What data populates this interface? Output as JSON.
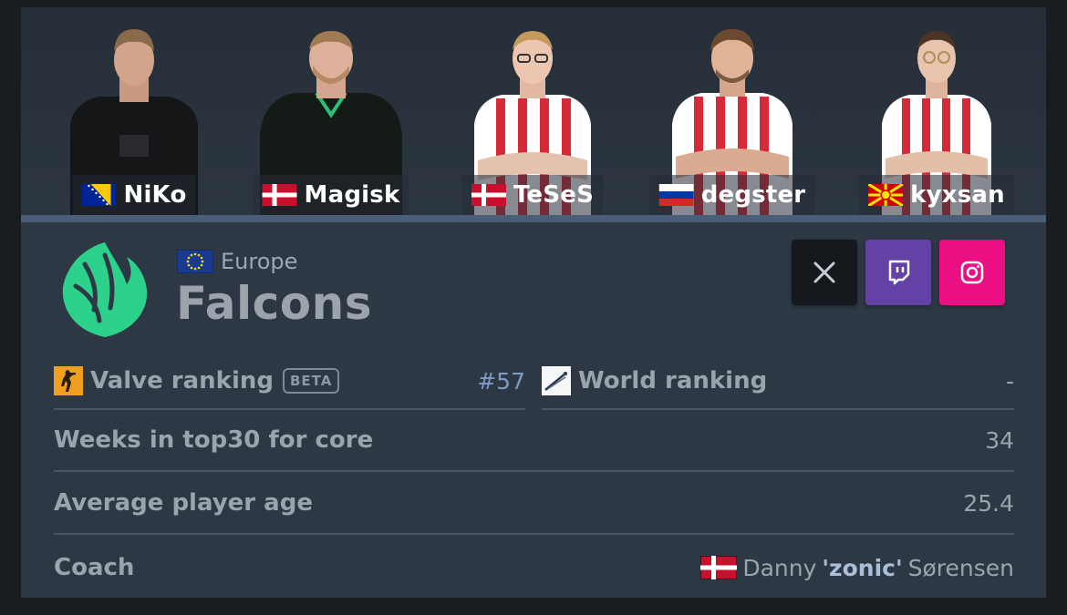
{
  "roster": [
    {
      "name": "NiKo",
      "flag": "bosnia"
    },
    {
      "name": "Magisk",
      "flag": "denmark"
    },
    {
      "name": "TeSeS",
      "flag": "denmark"
    },
    {
      "name": "degster",
      "flag": "russia"
    },
    {
      "name": "kyxsan",
      "flag": "north-macedonia"
    }
  ],
  "team": {
    "region": "Europe",
    "name": "Falcons",
    "brand_color": "#2cd28c"
  },
  "socials": [
    {
      "icon": "x-icon",
      "color": "#15191e"
    },
    {
      "icon": "twitch-icon",
      "color": "#6441a5"
    },
    {
      "icon": "instagram-icon",
      "color": "#ea0f82"
    }
  ],
  "stats": {
    "valve_label": "Valve ranking",
    "beta": "BETA",
    "valve_value": "#57",
    "world_label": "World ranking",
    "world_value": "-",
    "weeks_label": "Weeks in top30 for core",
    "weeks_value": "34",
    "age_label": "Average player age",
    "age_value": "25.4",
    "coach_label": "Coach",
    "coach_first": "Danny",
    "coach_nick": "'zonic'",
    "coach_last": "Sørensen"
  }
}
